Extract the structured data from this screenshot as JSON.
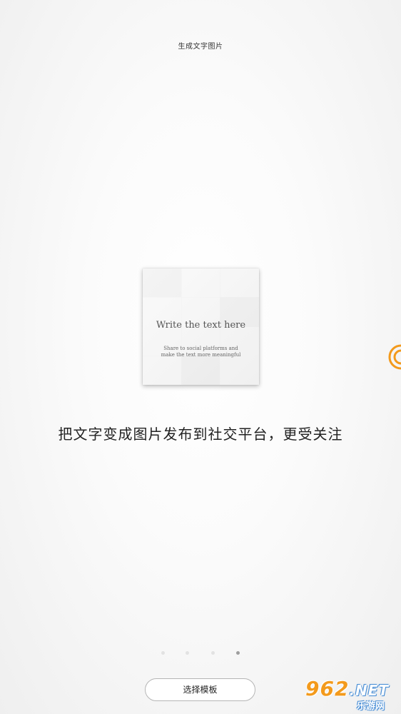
{
  "header": {
    "title": "生成文字图片"
  },
  "preview": {
    "heading": "Write the text here",
    "subtitle_line1": "Share to social platforms and",
    "subtitle_line2": "make the text more meaningful"
  },
  "tagline": "把文字变成图片发布到社交平台，更受关注",
  "pager": {
    "total": 4,
    "active_index": 3
  },
  "choose_template_button": {
    "label": "选择模板"
  },
  "side_icon": "floating-swirl-icon",
  "watermark": {
    "main": "962",
    "suffix": ".NET",
    "sub": "乐游网"
  },
  "colors": {
    "accent": "#f39a1c",
    "dot_inactive": "#e2e2e2",
    "dot_active": "#9e9e9e",
    "button_border": "#b5b5b5"
  }
}
